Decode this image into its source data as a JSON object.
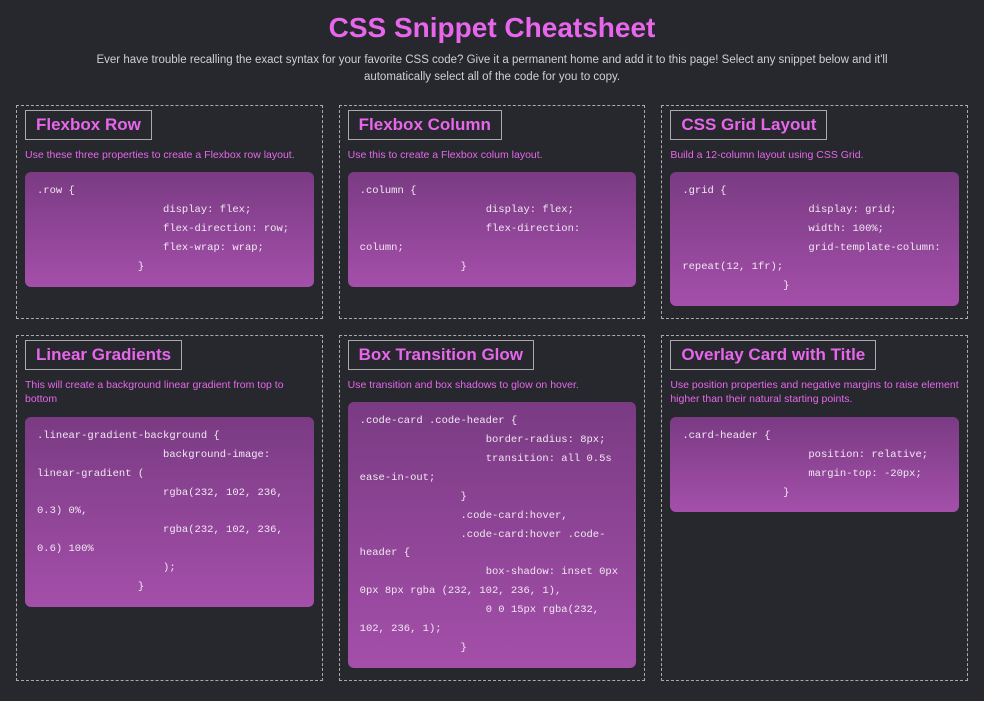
{
  "header": {
    "title": "CSS Snippet Cheatsheet",
    "subtitle": "Ever have trouble recalling the exact syntax for your favorite CSS code? Give it a permanent home and add it to this page! Select any snippet below and it'll automatically select all of the code for you to copy."
  },
  "cards": [
    {
      "title": "Flexbox Row",
      "desc": "Use these three properties to create a Flexbox row layout.",
      "code": ".row {\n                    display: flex;\n                    flex-direction: row;\n                    flex-wrap: wrap;\n                }"
    },
    {
      "title": "Flexbox Column",
      "desc": "Use this to create a Flexbox colum layout.",
      "code": ".column {\n                    display: flex;\n                    flex-direction: column;\n                }"
    },
    {
      "title": "CSS Grid Layout",
      "desc": "Build a 12-column layout using CSS Grid.",
      "code": ".grid {\n                    display: grid;\n                    width: 100%;\n                    grid-template-column: repeat(12, 1fr);\n                }"
    },
    {
      "title": "Linear Gradients",
      "desc": "This will create a background linear gradient from top to bottom",
      "code": ".linear-gradient-background {\n                    background-image: linear-gradient (\n                    rgba(232, 102, 236, 0.3) 0%,\n                    rgba(232, 102, 236, 0.6) 100%\n                    );\n                }"
    },
    {
      "title": "Box Transition Glow",
      "desc": "Use transition and box shadows to glow on hover.",
      "code": ".code-card .code-header {\n                    border-radius: 8px;\n                    transition: all 0.5s ease-in-out;\n                }\n                .code-card:hover,\n                .code-card:hover .code-header {\n                    box-shadow: inset 0px 0px 8px rgba (232, 102, 236, 1),\n                    0 0 15px rgba(232, 102, 236, 1);\n                }"
    },
    {
      "title": "Overlay Card with Title",
      "desc": "Use position properties and negative margins to raise element higher than their natural starting points.",
      "code": ".card-header {\n                    position: relative;\n                    margin-top: -20px;\n                }"
    }
  ]
}
